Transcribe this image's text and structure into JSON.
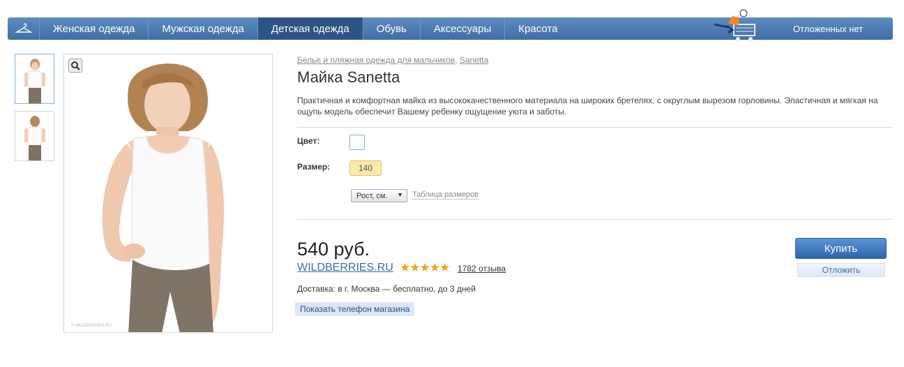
{
  "nav": {
    "items": [
      {
        "label": "Женская одежда"
      },
      {
        "label": "Мужская одежда"
      },
      {
        "label": "Детская одежда",
        "active": true
      },
      {
        "label": "Обувь"
      },
      {
        "label": "Аксессуары"
      },
      {
        "label": "Красота"
      }
    ],
    "deferred": "Отложенных нет",
    "home_icon": "hanger-icon",
    "mascot_icon": "shopping-cart-mascot-icon"
  },
  "gallery": {
    "zoom_icon": "magnifier-icon",
    "watermark": "© WILDBERRIES.RU"
  },
  "product": {
    "breadcrumb": [
      "Белье и пляжная одежда для мальчиков",
      "Sanetta"
    ],
    "breadcrumb_sep": ",",
    "title": "Майка Sanetta",
    "description": "Практичная и комфортная майка из высококачественного материала на широких бретелях, с округлым вырезом горловины. Эластичная и мягкая на ощупь модель обеспечит Вашему ребенку ощущение уюта и заботы.",
    "color_label": "Цвет:",
    "size_label": "Размер:",
    "size_value": "140",
    "height_select": "Рост, см.",
    "size_table": "Таблица размеров",
    "price": "540 руб.",
    "shop": "WILDBERRIES.RU",
    "rating": "★★★★★",
    "reviews": "1782 отзыва",
    "delivery": "Доставка: в г. Москва — бесплатно, до 3 дней",
    "show_phone": "Показать телефон магазина",
    "buy": "Купить",
    "defer": "Отложить"
  },
  "colors": {
    "nav_bg": "#4a7ab3",
    "nav_active": "#2c5484",
    "buy_bg": "#3a72b8",
    "star": "#f0a020",
    "size_chip": "#fbe9a9"
  }
}
